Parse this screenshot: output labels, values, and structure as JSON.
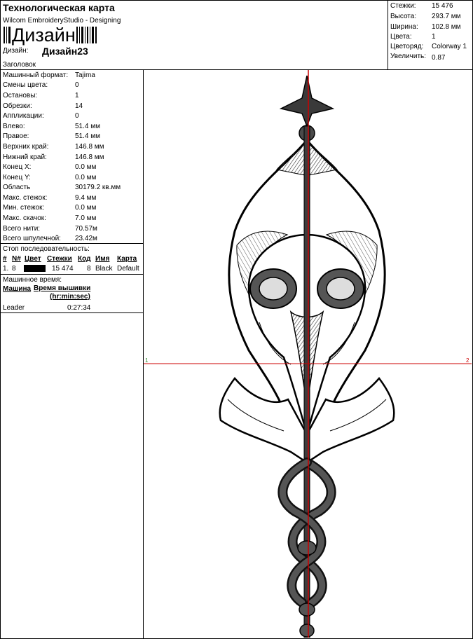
{
  "header": {
    "title": "Технологическая карта",
    "app": "Wilcom EmbroideryStudio - Designing",
    "logo_text": "Дизайн",
    "design_label": "Дизайн:",
    "design_name": "Дизайн23",
    "heading_label": "Заголовок"
  },
  "stats": [
    {
      "k": "Стежки:",
      "v": "15 476"
    },
    {
      "k": "Высота:",
      "v": "293.7 мм"
    },
    {
      "k": "Ширина:",
      "v": "102.8 мм"
    },
    {
      "k": "Цвета:",
      "v": "1"
    },
    {
      "k": "Цветоряд:",
      "v": "Colorway 1"
    },
    {
      "k": "Увеличить:",
      "v": "0.87"
    }
  ],
  "params": [
    {
      "k": "Машинный формат:",
      "v": "Tajima"
    },
    {
      "k": "Смены цвета:",
      "v": "0"
    },
    {
      "k": "Остановы:",
      "v": "1"
    },
    {
      "k": "Обрезки:",
      "v": "14"
    },
    {
      "k": "Аппликации:",
      "v": "0"
    },
    {
      "k": "Влево:",
      "v": "51.4 мм"
    },
    {
      "k": "Правое:",
      "v": "51.4 мм"
    },
    {
      "k": "Верхних край:",
      "v": "146.8 мм"
    },
    {
      "k": "Нижний край:",
      "v": "146.8 мм"
    },
    {
      "k": "Конец X:",
      "v": "0.0 мм"
    },
    {
      "k": "Конец Y:",
      "v": "0.0 мм"
    },
    {
      "k": "Область",
      "v": "30179.2 кв.мм"
    },
    {
      "k": "Макс. стежок:",
      "v": "9.4 мм"
    },
    {
      "k": "Мин. стежок:",
      "v": "0.0 мм"
    },
    {
      "k": "Макс. скачок:",
      "v": "7.0 мм"
    },
    {
      "k": "Всего нити:",
      "v": "70.57м"
    },
    {
      "k": "Всего шпулечной:",
      "v": "23.42м"
    }
  ],
  "stop_sequence": {
    "title": "Стоп последовательность:",
    "columns": [
      "#",
      "N#",
      "Цвет",
      "Стежки",
      "Код",
      "Имя",
      "Карта"
    ],
    "rows": [
      {
        "num": "1.",
        "n": "8",
        "color": "#000000",
        "stitches": "15 474",
        "code": "8",
        "name": "Black",
        "chart": "Default"
      }
    ]
  },
  "machine_time": {
    "title": "Машинное время:",
    "col_machine": "Машина",
    "col_time": "Время вышивки",
    "col_time_unit": "(hr:min:sec)",
    "rows": [
      {
        "machine": "Leader",
        "time": "0:27:34"
      }
    ]
  },
  "canvas": {
    "marker_left": "1",
    "marker_right": "2",
    "crosshair_color": "#cc0000"
  }
}
